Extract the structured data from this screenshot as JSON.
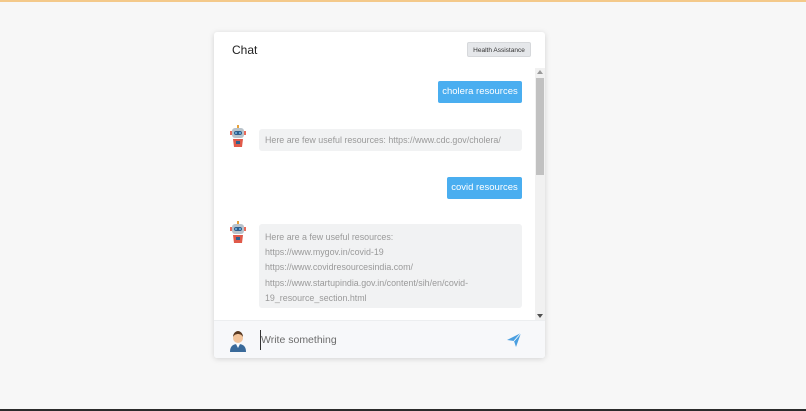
{
  "header": {
    "title": "Chat",
    "badge": "Health Assistance"
  },
  "messages": [
    {
      "sender": "user",
      "text": "cholera resources"
    },
    {
      "sender": "bot",
      "lines": [
        "Here are few useful resources: https://www.cdc.gov/cholera/"
      ]
    },
    {
      "sender": "user",
      "text": "covid resources"
    },
    {
      "sender": "bot",
      "lines": [
        "Here are a few useful resources:",
        "https://www.mygov.in/covid-19",
        "https://www.covidresourcesindia.com/",
        "https://www.startupindia.gov.in/content/sih/en/covid-",
        "19_resource_section.html"
      ]
    }
  ],
  "composer": {
    "placeholder": "Write something"
  },
  "colors": {
    "accent": "#4aaef0",
    "page_top_accent": "#f4c98a",
    "bot_bubble": "#f1f2f3"
  },
  "icons": {
    "bot": "robot-icon",
    "user": "user-icon",
    "send": "send-icon"
  }
}
